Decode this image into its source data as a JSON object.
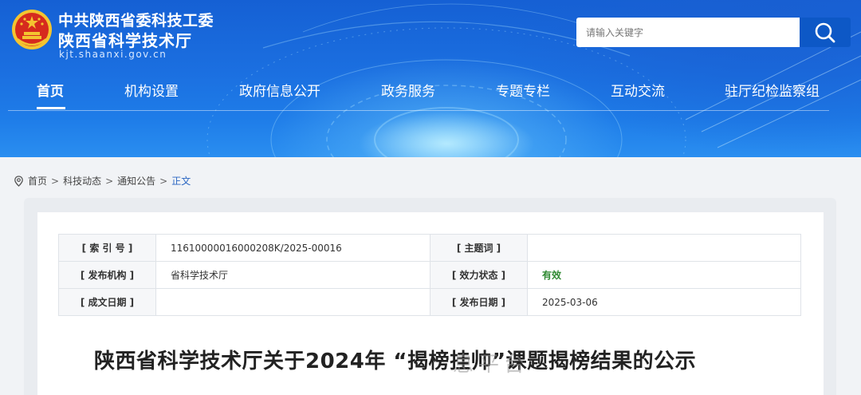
{
  "header": {
    "org_line1": "中共陕西省委科技工委",
    "org_line2": "陕西省科学技术厅",
    "domain": "kjt.shaanxi.gov.cn",
    "search_placeholder": "请输入关键字",
    "logo_icon": "national-emblem-icon",
    "search_icon": "search-icon"
  },
  "nav": {
    "items": [
      {
        "label": "首页",
        "active": true
      },
      {
        "label": "机构设置"
      },
      {
        "label": "政府信息公开"
      },
      {
        "label": "政务服务"
      },
      {
        "label": "专题专栏"
      },
      {
        "label": "互动交流"
      },
      {
        "label": "驻厅纪检监察组"
      }
    ]
  },
  "breadcrumb": {
    "icon": "location-pin-icon",
    "items": [
      "首页",
      "科技动态",
      "通知公告",
      "正文"
    ],
    "separator": ">"
  },
  "meta": {
    "index_label": "[ 索 引 号 ]",
    "index_value": "11610000016000208K/2025-00016",
    "keyword_label": "[ 主题词 ]",
    "keyword_value": "",
    "publisher_label": "[ 发布机构 ]",
    "publisher_value": "省科学技术厅",
    "status_label": "[ 效力状态 ]",
    "status_value": "有效",
    "created_label": "[ 成文日期 ]",
    "created_value": "",
    "published_label": "[ 发布日期 ]",
    "published_value": "2025-03-06"
  },
  "article": {
    "title": "陕西省科学技术厅关于2024年 “揭榜挂帅”课题揭榜结果的公示"
  },
  "watermark": {
    "text": "息平台"
  },
  "colors": {
    "banner_blue": "#1b6fe0",
    "search_button": "#0d58c6",
    "breadcrumb_current": "#2a66c2",
    "status_valid": "#2f8a32"
  }
}
